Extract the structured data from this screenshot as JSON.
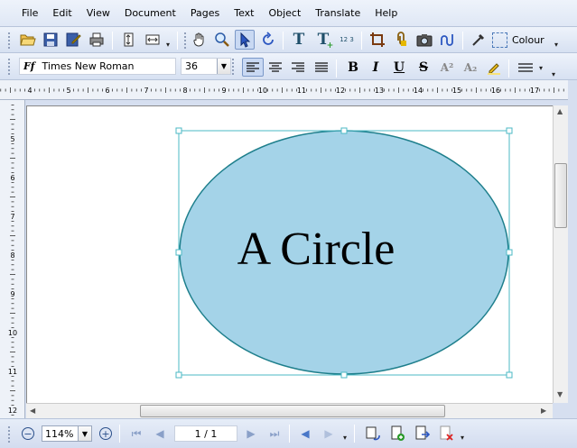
{
  "menu": [
    "File",
    "Edit",
    "View",
    "Document",
    "Pages",
    "Text",
    "Object",
    "Translate",
    "Help"
  ],
  "toolbar": {
    "colour_label": "Colour",
    "text_button": "T",
    "number_tool_label": "12 3"
  },
  "format_bar": {
    "font_icon": "Ff",
    "font_name": "Times New Roman",
    "font_size": "36",
    "bold": "B",
    "italic": "I",
    "underline": "U",
    "strike": "S",
    "superscript": "A²",
    "subscript": "A₂"
  },
  "ruler_h_numbers": [
    "4",
    "5",
    "6",
    "7",
    "8",
    "9",
    "10",
    "11",
    "12",
    "13",
    "14",
    "15",
    "16",
    "17"
  ],
  "ruler_v_numbers": [
    "5",
    "6",
    "7",
    "8",
    "9",
    "10",
    "11",
    "12"
  ],
  "canvas": {
    "shape_text": "A Circle",
    "fill": "#a4d3e8",
    "stroke": "#1e7f8c",
    "selection": "#4bb8c4"
  },
  "status": {
    "zoom": "114%",
    "page": "1 / 1",
    "zoom_out_label": "−",
    "zoom_in_label": "+"
  }
}
